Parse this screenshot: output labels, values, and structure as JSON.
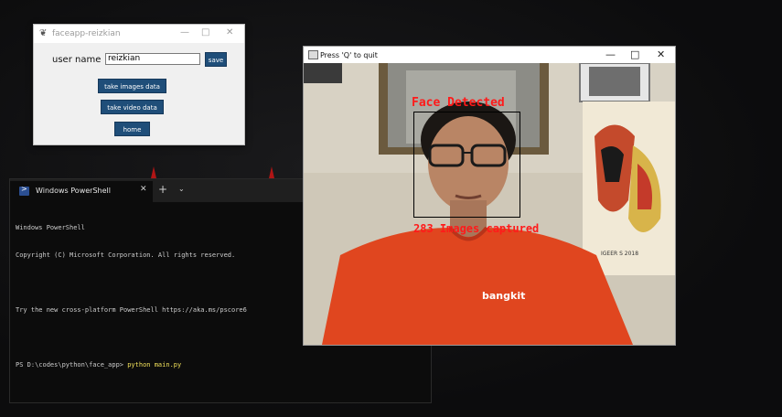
{
  "tk_window": {
    "title": "faceapp-reizkian",
    "user_label": "user name",
    "user_value": "reizkian",
    "save_label": "save",
    "take_images_label": "take images data",
    "take_video_label": "take video data",
    "home_label": "home"
  },
  "powershell": {
    "tab_title": "Windows PowerShell",
    "lines": [
      "Windows PowerShell",
      "Copyright (C) Microsoft Corporation. All rights reserved.",
      "",
      "Try the new cross-platform PowerShell https://aka.ms/pscore6",
      ""
    ],
    "prompt": "PS D:\\codes\\python\\face_app> ",
    "command": "python main.py"
  },
  "camera_window": {
    "title": "Press 'Q' to quit",
    "face_label": "Face Detected",
    "capture_label": "283 Images captured",
    "shirt_logo": "bangkit",
    "painting_text": "IGEER S 2018"
  },
  "colors": {
    "overlay_text": "#ff1a1a",
    "button_bg": "#1f4e79",
    "shirt": "#e0461f"
  }
}
